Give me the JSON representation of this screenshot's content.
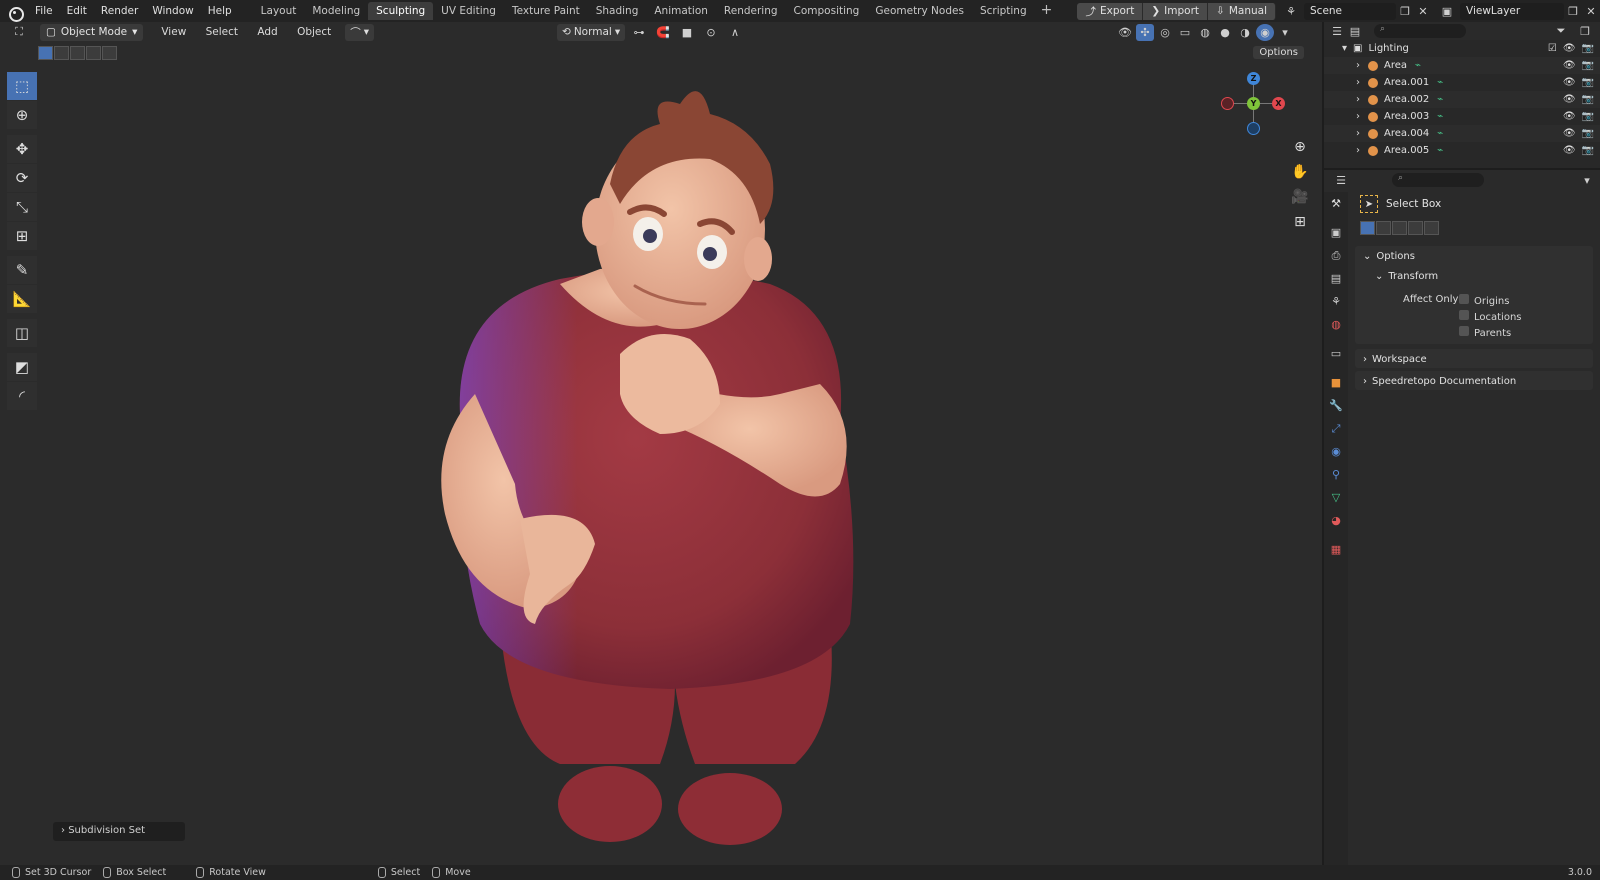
{
  "menu": [
    "File",
    "Edit",
    "Render",
    "Window",
    "Help"
  ],
  "workspaces": [
    "Layout",
    "Modeling",
    "Sculpting",
    "UV Editing",
    "Texture Paint",
    "Shading",
    "Animation",
    "Rendering",
    "Compositing",
    "Geometry Nodes",
    "Scripting"
  ],
  "active_workspace": "Sculpting",
  "topright": {
    "export": "Export",
    "import": "Import",
    "manual": "Manual",
    "scene": "Scene",
    "viewlayer": "ViewLayer"
  },
  "viewport": {
    "mode": "Object Mode",
    "menus": [
      "View",
      "Select",
      "Add",
      "Object"
    ],
    "orientation": "Normal",
    "options": "Options",
    "last_op": "Subdivision Set",
    "gizmo": {
      "z": "Z",
      "y": "Y",
      "x": "X"
    }
  },
  "outliner": {
    "collection": "Lighting",
    "items": [
      "Area",
      "Area.001",
      "Area.002",
      "Area.003",
      "Area.004",
      "Area.005"
    ]
  },
  "properties": {
    "tool_name": "Select Box",
    "panels": {
      "options": "Options",
      "transform": "Transform",
      "affect_only": "Affect Only",
      "workspace": "Workspace",
      "speedretopo": "Speedretopo Documentation"
    },
    "affect": [
      "Origins",
      "Locations",
      "Parents"
    ]
  },
  "status": {
    "set_cursor": "Set 3D Cursor",
    "box_select": "Box Select",
    "rotate_view": "Rotate View",
    "select": "Select",
    "move": "Move",
    "version": "3.0.0"
  },
  "colors": {
    "accent": "#4772b3",
    "shirt": "#8c2f38",
    "skin": "#e8b295",
    "hair": "#8a4634",
    "axis_x": "#e0474e",
    "axis_y": "#7fc43a",
    "axis_z": "#3f86d8"
  }
}
